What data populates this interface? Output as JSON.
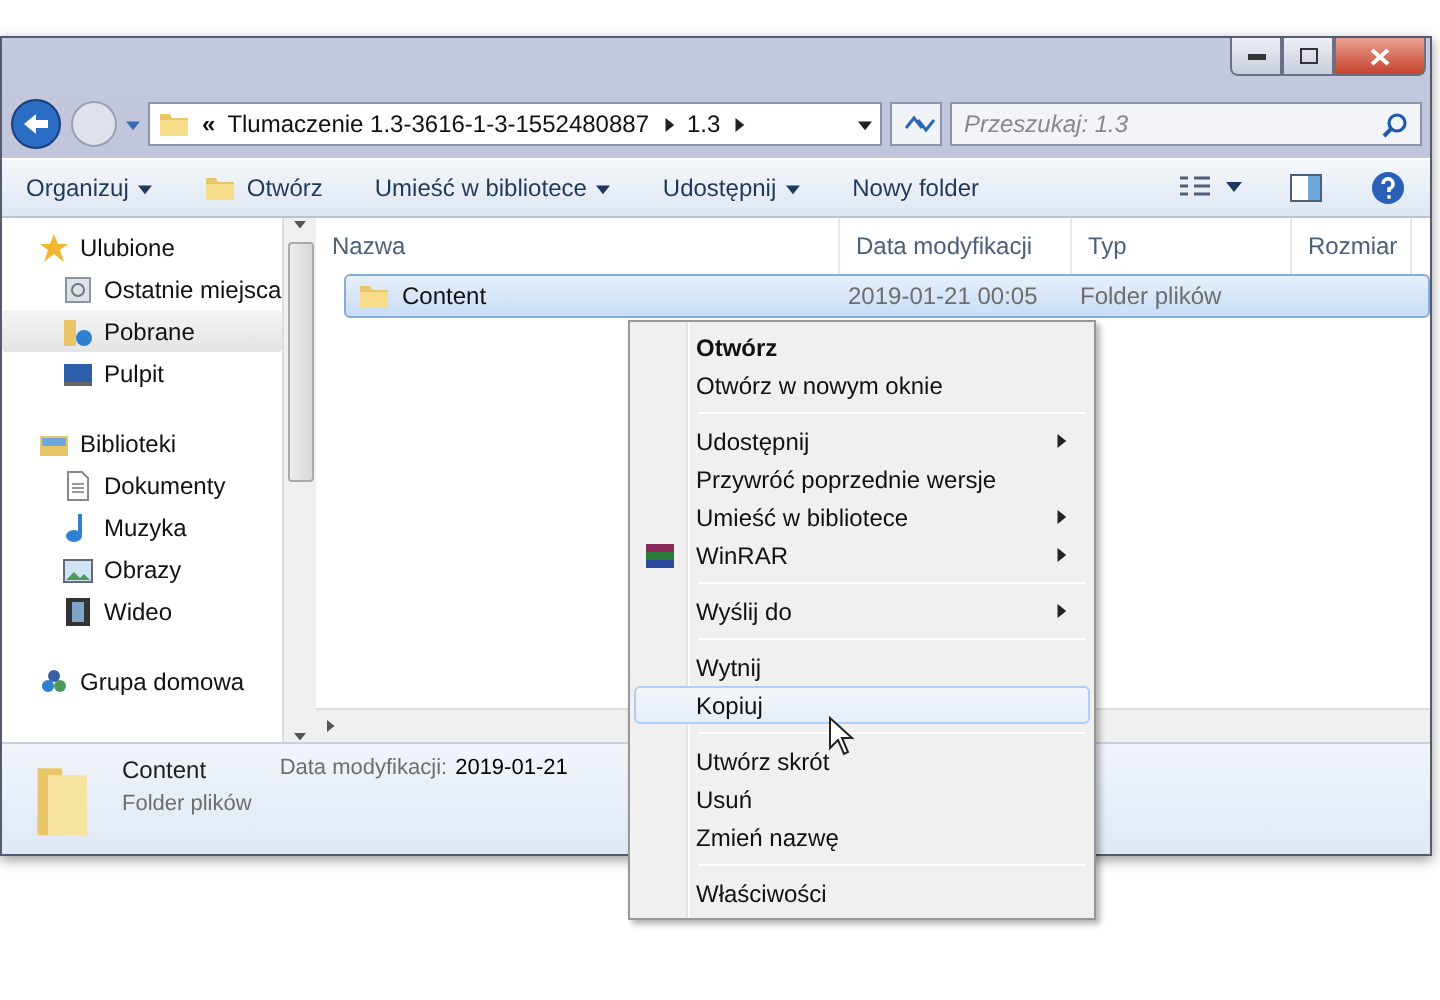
{
  "address": {
    "overflow": "«",
    "crumbs": [
      "Tlumaczenie 1.3-3616-1-3-1552480887",
      "1.3"
    ]
  },
  "search": {
    "placeholder": "Przeszukaj: 1.3"
  },
  "toolbar": [
    {
      "label": "Organizuj",
      "dropdown": true
    },
    {
      "label": "Otwórz",
      "dropdown": false
    },
    {
      "label": "Umieść w bibliotece",
      "dropdown": true
    },
    {
      "label": "Udostępnij",
      "dropdown": true
    },
    {
      "label": "Nowy folder",
      "dropdown": false
    }
  ],
  "sidebar": [
    {
      "label": "Ulubione",
      "children": [
        {
          "label": "Ostatnie miejsca",
          "selected": false
        },
        {
          "label": "Pobrane",
          "selected": true
        },
        {
          "label": "Pulpit",
          "selected": false
        }
      ]
    },
    {
      "label": "Biblioteki",
      "children": [
        {
          "label": "Dokumenty",
          "selected": false
        },
        {
          "label": "Muzyka",
          "selected": false
        },
        {
          "label": "Obrazy",
          "selected": false
        },
        {
          "label": "Wideo",
          "selected": false
        }
      ]
    },
    {
      "label": "Grupa domowa"
    }
  ],
  "table": {
    "columns": [
      "Nazwa",
      "Data modyfikacji",
      "Typ",
      "Rozmiar"
    ],
    "rows": [
      {
        "name": "Content",
        "date": "2019-01-21 00:05",
        "type": "Folder plików",
        "selected": true
      }
    ]
  },
  "context_menu": [
    {
      "kind": "item",
      "label": "Otwórz",
      "bold": true,
      "submenu": false,
      "selected": false
    },
    {
      "kind": "item",
      "label": "Otwórz w nowym oknie",
      "bold": false,
      "submenu": false,
      "selected": false
    },
    {
      "kind": "separator"
    },
    {
      "kind": "item",
      "label": "Udostępnij",
      "bold": false,
      "submenu": true,
      "selected": false
    },
    {
      "kind": "item",
      "label": "Przywróć poprzednie wersje",
      "bold": false,
      "submenu": false,
      "selected": false
    },
    {
      "kind": "item",
      "label": "Umieść w bibliotece",
      "bold": false,
      "submenu": true,
      "selected": false
    },
    {
      "kind": "item",
      "label": "WinRAR",
      "bold": false,
      "submenu": true,
      "selected": false,
      "icon": true
    },
    {
      "kind": "separator"
    },
    {
      "kind": "item",
      "label": "Wyślij do",
      "bold": false,
      "submenu": true,
      "selected": false
    },
    {
      "kind": "separator"
    },
    {
      "kind": "item",
      "label": "Wytnij",
      "bold": false,
      "submenu": false,
      "selected": false
    },
    {
      "kind": "item",
      "label": "Kopiuj",
      "bold": false,
      "submenu": false,
      "selected": true
    },
    {
      "kind": "separator"
    },
    {
      "kind": "item",
      "label": "Utwórz skrót",
      "bold": false,
      "submenu": false,
      "selected": false
    },
    {
      "kind": "item",
      "label": "Usuń",
      "bold": false,
      "submenu": false,
      "selected": false
    },
    {
      "kind": "item",
      "label": "Zmień nazwę",
      "bold": false,
      "submenu": false,
      "selected": false
    },
    {
      "kind": "separator"
    },
    {
      "kind": "item",
      "label": "Właściwości",
      "bold": false,
      "submenu": false,
      "selected": false
    }
  ],
  "details": {
    "name": "Content",
    "type": "Folder plików",
    "date_label": "Data modyfikacji:",
    "date": "2019-01-21"
  }
}
